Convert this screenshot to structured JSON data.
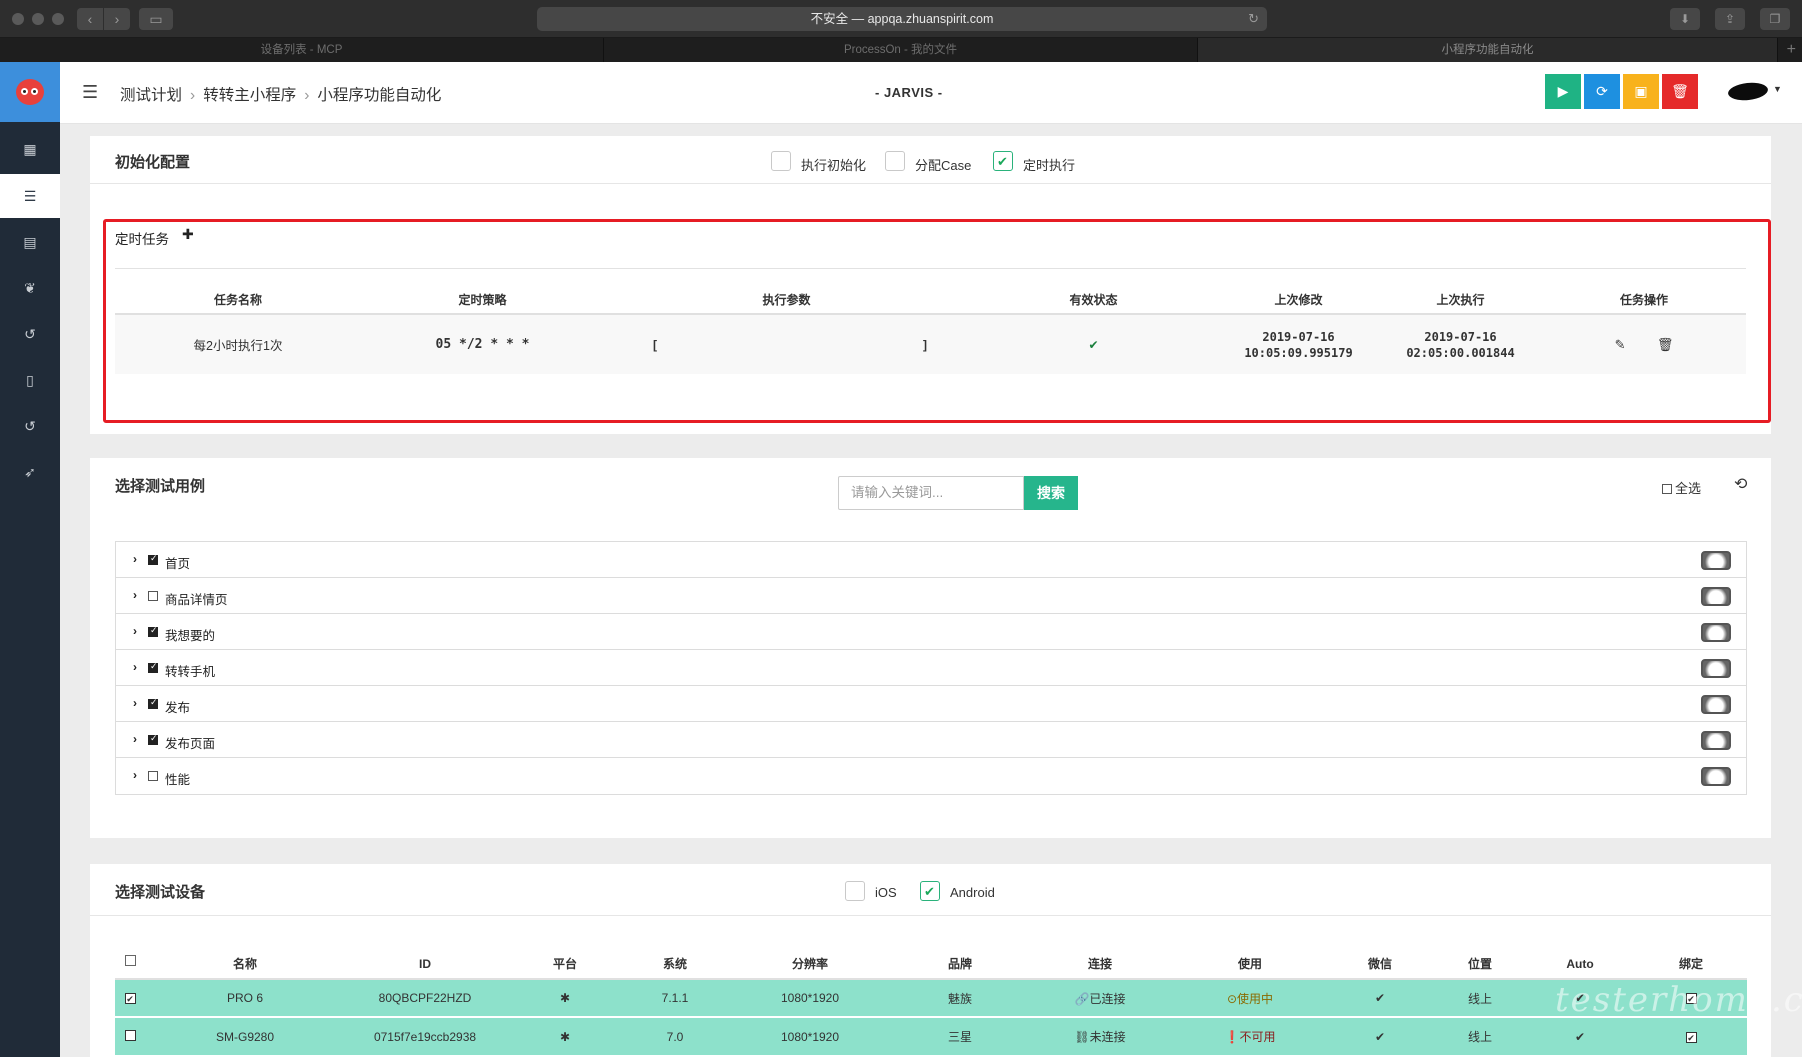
{
  "browser": {
    "url": "不安全 — appqa.zhuanspirit.com",
    "tabs": [
      "设备列表 - MCP",
      "ProcessOn - 我的文件",
      "小程序功能自动化"
    ],
    "new_tab": "+"
  },
  "sidebar": {
    "icons": [
      "grid-icon",
      "list-icon",
      "table-icon",
      "leaf-icon",
      "history-icon",
      "mobile-icon",
      "history-icon",
      "send-icon"
    ],
    "active_index": 1
  },
  "header": {
    "menu_icon": "☰",
    "breadcrumb": [
      "测试计划",
      "转转主小程序",
      "小程序功能自动化"
    ],
    "center_title": "- JARVIS -",
    "actions": [
      {
        "name": "play-button",
        "glyph": "▶",
        "color": "#1fb384"
      },
      {
        "name": "refresh-button",
        "glyph": "⟳",
        "color": "#1e90e0"
      },
      {
        "name": "save-button",
        "glyph": "▣",
        "color": "#f8b21c"
      },
      {
        "name": "delete-button",
        "glyph": "🗑",
        "color": "#e52a2a"
      }
    ]
  },
  "init_config": {
    "title": "初始化配置",
    "options": [
      {
        "label": "执行初始化",
        "checked": false
      },
      {
        "label": "分配Case",
        "checked": false
      },
      {
        "label": "定时执行",
        "checked": true
      }
    ]
  },
  "scheduled": {
    "title": "定时任务",
    "add_glyph": "✚",
    "columns": [
      "任务名称",
      "定时策略",
      "执行参数",
      "有效状态",
      "上次修改",
      "上次执行",
      "任务操作"
    ],
    "rows": [
      {
        "name": "每2小时执行1次",
        "cron": "05 */2 * * *",
        "params_open": "[",
        "params_close": "]",
        "status": "✔",
        "modified_date": "2019-07-16",
        "modified_time": "10:05:09.995179",
        "executed_date": "2019-07-16",
        "executed_time": "02:05:00.001844"
      }
    ]
  },
  "cases": {
    "title": "选择测试用例",
    "search_placeholder": "请输入关键词...",
    "search_button": "搜索",
    "select_all": "全选",
    "items": [
      {
        "label": "首页",
        "checked": true
      },
      {
        "label": "商品详情页",
        "checked": false
      },
      {
        "label": "我想要的",
        "checked": true
      },
      {
        "label": "转转手机",
        "checked": true
      },
      {
        "label": "发布",
        "checked": true
      },
      {
        "label": "发布页面",
        "checked": true
      },
      {
        "label": "性能",
        "checked": false
      }
    ]
  },
  "devices": {
    "title": "选择测试设备",
    "platforms": [
      {
        "label": "iOS",
        "checked": false
      },
      {
        "label": "Android",
        "checked": true
      }
    ],
    "columns": [
      "名称",
      "ID",
      "平台",
      "系统",
      "分辨率",
      "品牌",
      "连接",
      "使用",
      "微信",
      "位置",
      "Auto",
      "绑定"
    ],
    "rows": [
      {
        "selected": true,
        "name": "PRO 6",
        "id": "80QBCPF22HZD",
        "platform": "android-icon",
        "os": "7.1.1",
        "resolution": "1080*1920",
        "brand": "魅族",
        "connection": "已连接",
        "usage": "使用中",
        "wechat": "✔",
        "location": "线上",
        "auto": "✔",
        "bound": true
      },
      {
        "selected": false,
        "name": "SM-G9280",
        "id": "0715f7e19ccb2938",
        "platform": "android-icon",
        "os": "7.0",
        "resolution": "1080*1920",
        "brand": "三星",
        "connection": "未连接",
        "usage": "不可用",
        "wechat": "✔",
        "location": "线上",
        "auto": "✔",
        "bound": true
      }
    ]
  },
  "watermark": "testerhome.com"
}
